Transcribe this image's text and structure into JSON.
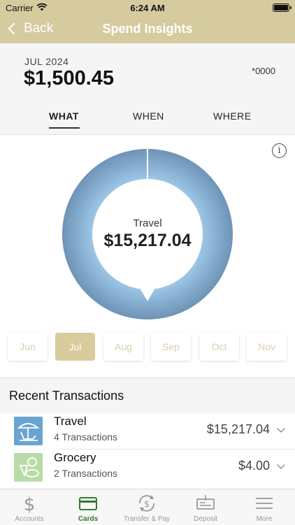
{
  "status_bar": {
    "carrier": "Carrier",
    "time": "6:24 AM"
  },
  "nav": {
    "back_label": "Back",
    "title": "Spend Insights"
  },
  "summary": {
    "period": "JUL 2024",
    "total": "$1,500.45",
    "account": "*0000"
  },
  "tabs": [
    {
      "label": "WHAT",
      "active": true
    },
    {
      "label": "WHEN",
      "active": false
    },
    {
      "label": "WHERE",
      "active": false
    }
  ],
  "donut": {
    "category": "Travel",
    "amount": "$15,217.04",
    "fill_fraction": 1.0,
    "ring_color": "#8db5d8",
    "ring_edge_color": "#6e93b6"
  },
  "months": [
    {
      "label": "Jun",
      "selected": false
    },
    {
      "label": "Jul",
      "selected": true
    },
    {
      "label": "Aug",
      "selected": false
    },
    {
      "label": "Sep",
      "selected": false
    },
    {
      "label": "Oct",
      "selected": false
    },
    {
      "label": "Nov",
      "selected": false
    }
  ],
  "recent": {
    "title": "Recent Transactions"
  },
  "transactions": [
    {
      "name": "Travel",
      "count": "4 Transactions",
      "amount": "$15,217.04",
      "icon": "beach-chair-umbrella-icon",
      "icon_color": "#6aa4d0"
    },
    {
      "name": "Grocery",
      "count": "2 Transactions",
      "amount": "$4.00",
      "icon": "grocery-food-icon",
      "icon_color": "#b8dca8"
    }
  ],
  "tabbar": [
    {
      "label": "Accounts",
      "icon": "dollar-sign-icon",
      "active": false
    },
    {
      "label": "Cards",
      "icon": "credit-card-icon",
      "active": true
    },
    {
      "label": "Transfer & Pay",
      "icon": "transfer-dollar-icon",
      "active": false
    },
    {
      "label": "Deposit",
      "icon": "check-deposit-icon",
      "active": false
    },
    {
      "label": "More",
      "icon": "menu-lines-icon",
      "active": false
    }
  ],
  "colors": {
    "brand_gold": "#d6cb9f",
    "active_green": "#2f7d2f",
    "month_text": "#d9cfa7"
  }
}
